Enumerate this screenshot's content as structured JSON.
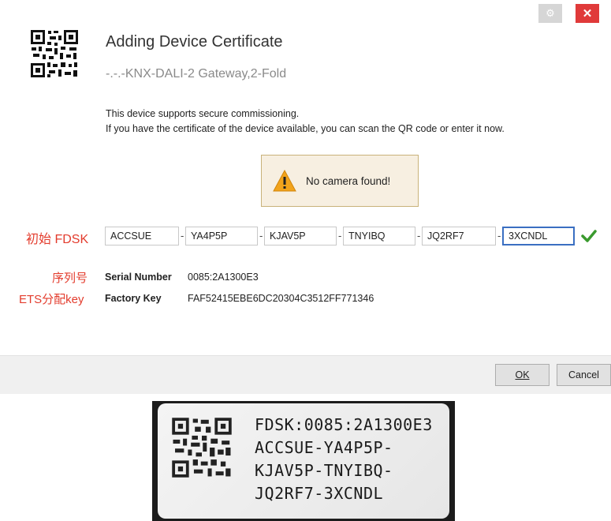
{
  "window": {
    "settings_icon": "gear-icon",
    "close_icon": "close-icon",
    "close_glyph": "✕",
    "settings_glyph": "⚙"
  },
  "header": {
    "title": "Adding Device Certificate",
    "subtitle": "-.-.-KNX-DALI-2 Gateway,2-Fold"
  },
  "description": {
    "line1": "This device supports secure commissioning.",
    "line2": "If you have the certificate of the device available, you can scan the QR code or enter it now."
  },
  "warning": {
    "icon": "warning-icon",
    "text": "No camera found!"
  },
  "fdsk": {
    "annotation": "初始 FDSK",
    "separator": "-",
    "fields": [
      "ACCSUE",
      "YA4P5P",
      "KJAV5P",
      "TNYIBQ",
      "JQ2RF7",
      "3XCNDL"
    ],
    "valid_icon": "checkmark-icon"
  },
  "info": {
    "serial_annotation": "序列号",
    "serial_label": "Serial Number",
    "serial_value": "0085:2A1300E3",
    "factory_annotation": "ETS分配key",
    "factory_label": "Factory Key",
    "factory_value": "FAF52415EBE6DC20304C3512FF771346"
  },
  "buttons": {
    "ok": "OK",
    "cancel": "Cancel"
  },
  "sticker": {
    "lines": [
      "FDSK:0085:2A1300E3",
      "ACCSUE-YA4P5P-",
      "KJAV5P-TNYIBQ-",
      "JQ2RF7-3XCNDL"
    ]
  },
  "colors": {
    "annotation_red": "#e33c2d",
    "close_red": "#e03a3a",
    "check_green": "#3a9a2e",
    "focus_blue": "#3a6fc2"
  }
}
